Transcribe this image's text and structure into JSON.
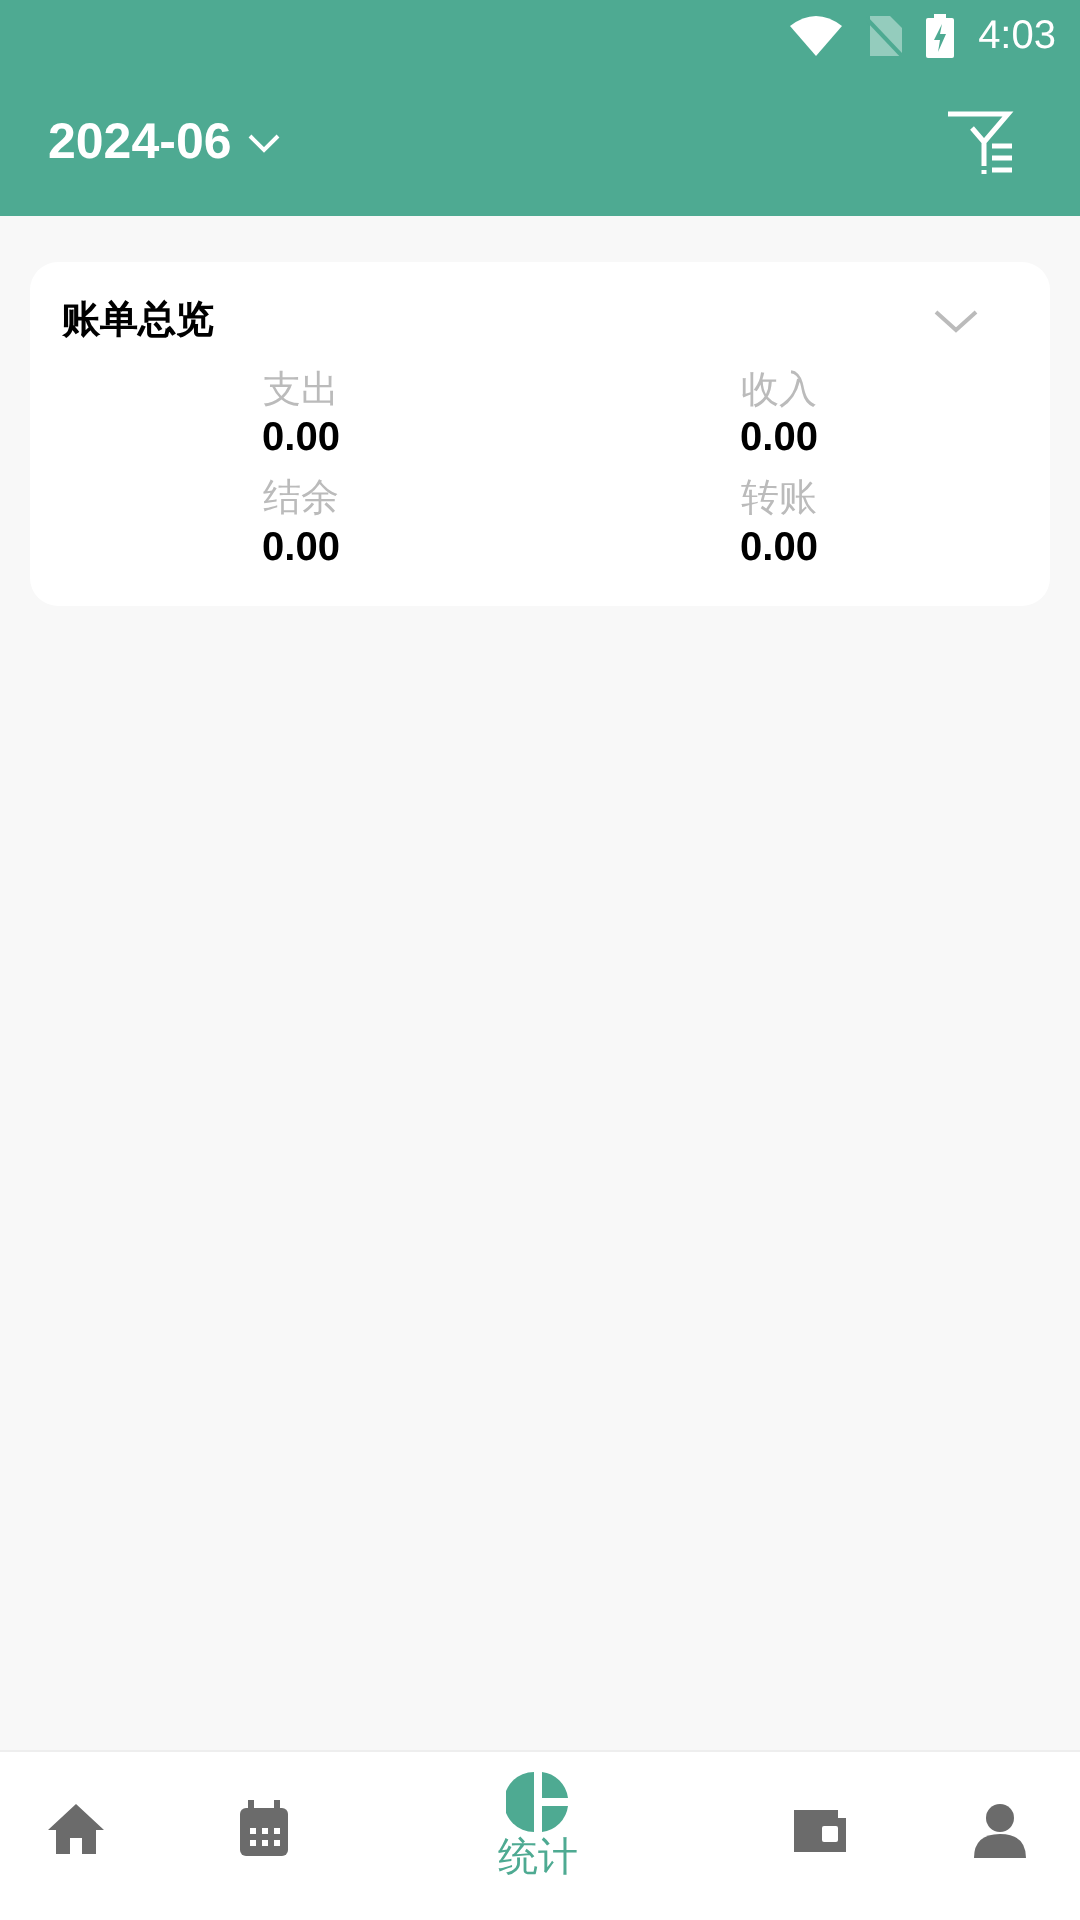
{
  "status_bar": {
    "time": "4:03"
  },
  "header": {
    "month": "2024-06"
  },
  "overview": {
    "title": "账单总览",
    "expanded": false,
    "stats": [
      {
        "label": "支出",
        "value": "0.00"
      },
      {
        "label": "收入",
        "value": "0.00"
      },
      {
        "label": "结余",
        "value": "0.00"
      },
      {
        "label": "转账",
        "value": "0.00"
      }
    ]
  },
  "bottom_nav": [
    {
      "kind": "home",
      "selected": false
    },
    {
      "kind": "calendar",
      "selected": false
    },
    {
      "kind": "stats",
      "selected": true,
      "label": "统计"
    },
    {
      "kind": "wallet",
      "selected": false
    },
    {
      "kind": "person",
      "selected": false
    }
  ]
}
